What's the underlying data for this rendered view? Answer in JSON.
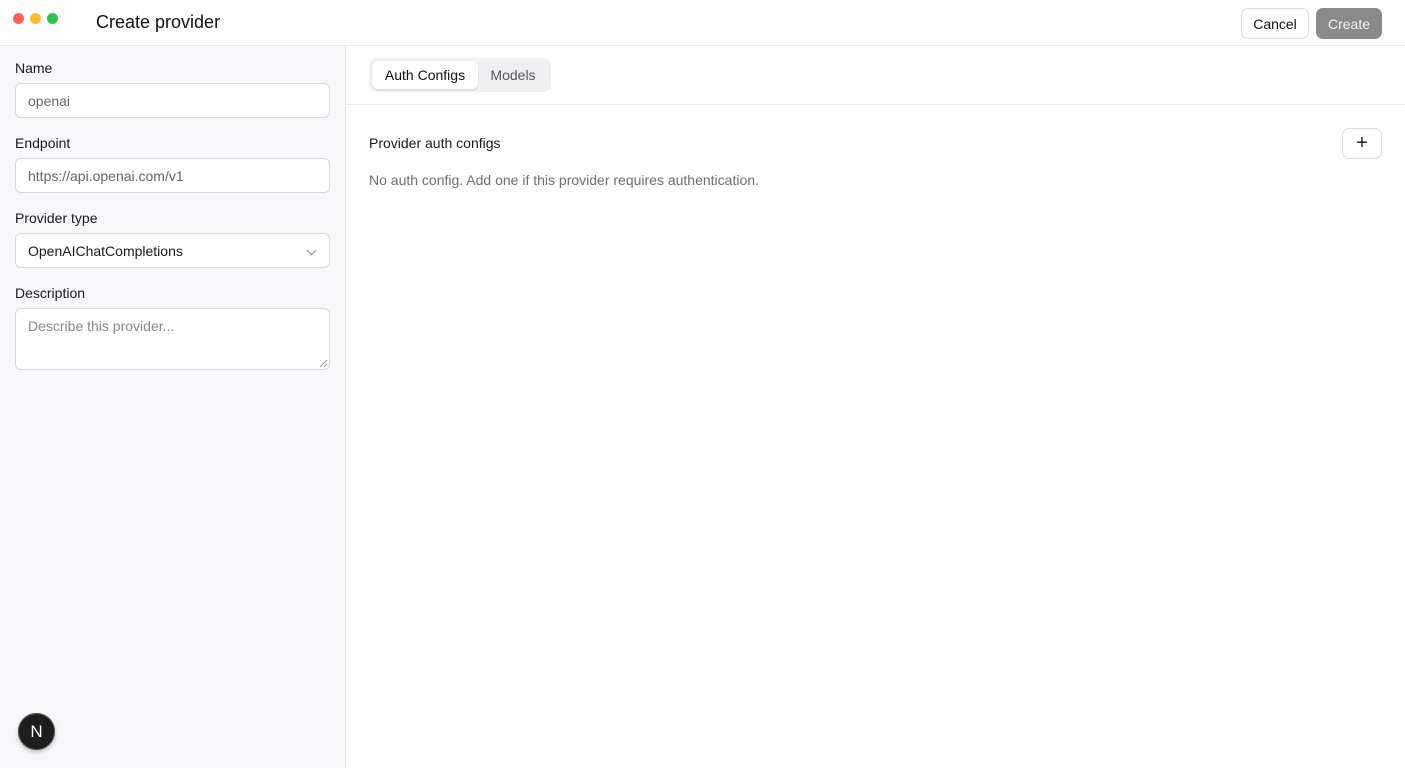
{
  "window": {
    "title": "Create provider"
  },
  "toolbar": {
    "cancel_label": "Cancel",
    "create_label": "Create"
  },
  "form": {
    "name": {
      "label": "Name",
      "value": "openai"
    },
    "endpoint": {
      "label": "Endpoint",
      "value": "https://api.openai.com/v1"
    },
    "provider_type": {
      "label": "Provider type",
      "selected": "OpenAIChatCompletions"
    },
    "description": {
      "label": "Description",
      "placeholder": "Describe this provider..."
    }
  },
  "avatar": {
    "initial": "N"
  },
  "tabs": [
    {
      "label": "Auth Configs",
      "active": true
    },
    {
      "label": "Models",
      "active": false
    }
  ],
  "auth_configs": {
    "title": "Provider auth configs",
    "add_label": "+",
    "empty_message": "No auth config. Add one if this provider requires authentication."
  },
  "colors": {
    "close": "#ff5f57",
    "minimize": "#febc2e",
    "zoom": "#28c840",
    "create_button": "#8a8a8a"
  }
}
